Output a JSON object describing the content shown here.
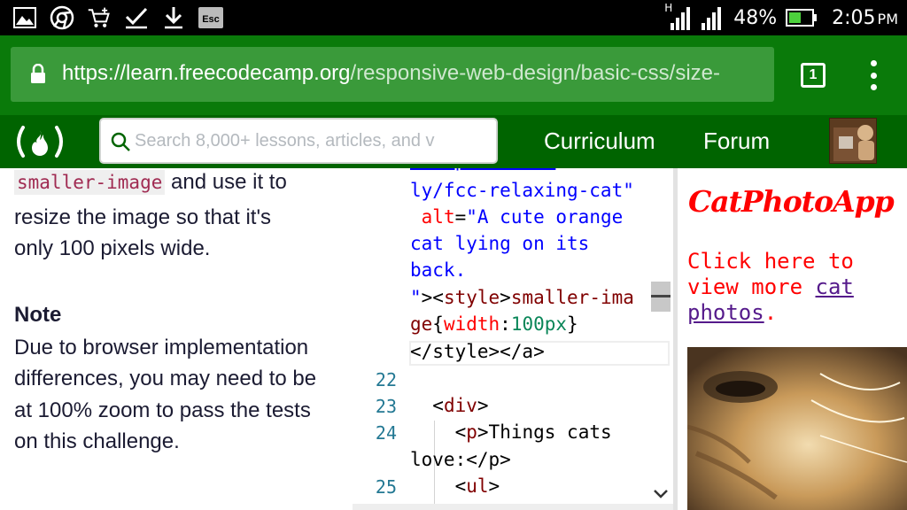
{
  "status_bar": {
    "battery": "48%",
    "time": "2:05",
    "ampm": "PM",
    "network": "H",
    "icons": [
      "image-icon",
      "chrome-icon",
      "cart-icon",
      "check-icon",
      "download-icon",
      "esc-icon",
      "signal-icon",
      "battery-icon"
    ],
    "esc_label": "Esc"
  },
  "browser": {
    "url_host": "https://learn.freecodecamp.org",
    "url_path": "/responsive-web-design/basic-css/size-",
    "tab_count": "1"
  },
  "nav": {
    "search_placeholder": "Search 8,000+ lessons, articles, and v",
    "curriculum": "Curriculum",
    "forum": "Forum",
    "logo_text": "(🔥)"
  },
  "instructions": {
    "code_term": "smaller-image",
    "line1_rest": " and use it to",
    "line2": "resize the image so that it's",
    "line3": "only 100 pixels wide.",
    "note_title": "Note",
    "note_text": "Due to browser implementation differences, you may need to be at 100% zoom to pass the tests on this challenge."
  },
  "editor": {
    "line_numbers": [
      "22",
      "23",
      "24",
      "25"
    ],
    "lines": {
      "l0": "ly/fcc-relaxing-cat\"",
      "l1_attr": "alt",
      "l1_str": "\"A cute orange",
      "l2": "cat lying on its",
      "l3": "back.",
      "l4_q": "\"",
      "l4_tag1": "><",
      "l4_style": "style",
      "l4_gt": ">",
      "l4_txt": "smaller-ima",
      "l5_sel": "ge",
      "l5_brace_open": "{",
      "l5_prop": "width",
      "l5_colon": ":",
      "l5_val": "100px",
      "l5_brace_close": "}",
      "l6": "</style></a>",
      "l7_open": "<",
      "l7_tag": "div",
      "l7_close": ">",
      "l8_open": "<",
      "l8_tag": "p",
      "l8_close": ">",
      "l8_txt": "Things cats",
      "l9_txt": "love:",
      "l9_close": "</p>",
      "l10_open": "<",
      "l10_tag": "ul",
      "l10_close": ">"
    }
  },
  "preview": {
    "title": "CatPhotoApp",
    "text_before": "Click here to view more ",
    "link": "cat photos",
    "text_after": "."
  },
  "colors": {
    "status_bg": "#000000",
    "browser_bg": "#0a7a0a",
    "nav_bg": "#006400",
    "preview_red": "#ff0000",
    "link_purple": "#551a8b"
  }
}
